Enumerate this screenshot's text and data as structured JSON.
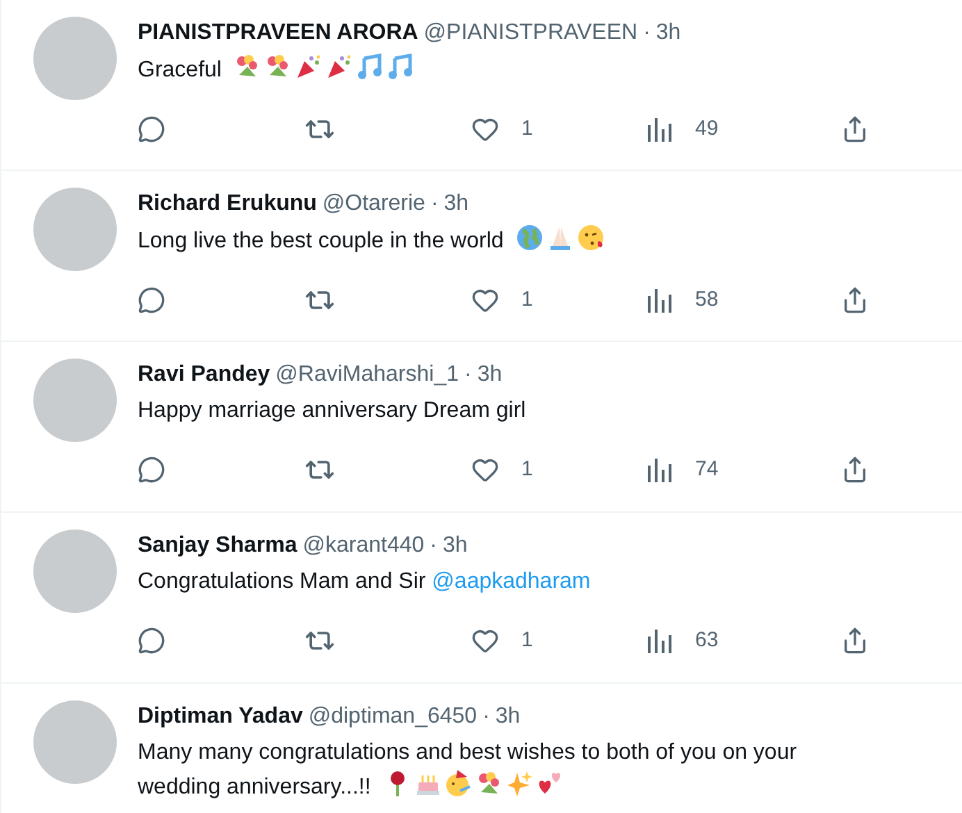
{
  "replies": [
    {
      "name": "PIANISTPRAVEEN ARORA",
      "handle": "@PIANISTPRAVEEN",
      "separator": "·",
      "time": "3h",
      "lines": [
        "Graceful"
      ],
      "emojis": [
        {
          "kind": "bouquet"
        },
        {
          "kind": "bouquet"
        },
        {
          "kind": "popper"
        },
        {
          "kind": "popper"
        },
        {
          "kind": "notes"
        },
        {
          "kind": "notes"
        }
      ],
      "likes": "1",
      "liked": false,
      "views": "49"
    },
    {
      "name": "Richard Erukunu",
      "handle": "@Otarerie",
      "separator": "·",
      "time": "3h",
      "lines": [
        "Long live the best couple in the world"
      ],
      "emojis": [
        {
          "kind": "globe"
        },
        {
          "kind": "pray"
        },
        {
          "kind": "kiss"
        }
      ],
      "likes": "1",
      "liked": false,
      "views": "58"
    },
    {
      "name": "Ravi Pandey",
      "handle": "@RaviMaharshi_1",
      "separator": "·",
      "time": "3h",
      "lines": [
        "Happy marriage anniversary Dream girl"
      ],
      "likes": "1",
      "liked": false,
      "views": "74"
    },
    {
      "name": "Sanjay Sharma",
      "handle": "@karant440",
      "separator": "·",
      "time": "3h",
      "lines": [
        "Congratulations Mam and Sir"
      ],
      "mention": "@aapkadharam",
      "likes": "1",
      "liked": false,
      "views": "63"
    },
    {
      "name": "Diptiman Yadav",
      "handle": "@diptiman_6450",
      "separator": "·",
      "time": "3h",
      "lines": [
        "Many many congratulations and best wishes to both of you on your",
        "wedding anniversary...!!"
      ],
      "emojis": [
        {
          "kind": "rose"
        },
        {
          "kind": "cake"
        },
        {
          "kind": "party-face"
        },
        {
          "kind": "bouquet"
        },
        {
          "kind": "sparkles"
        },
        {
          "kind": "hearts"
        }
      ]
    }
  ]
}
